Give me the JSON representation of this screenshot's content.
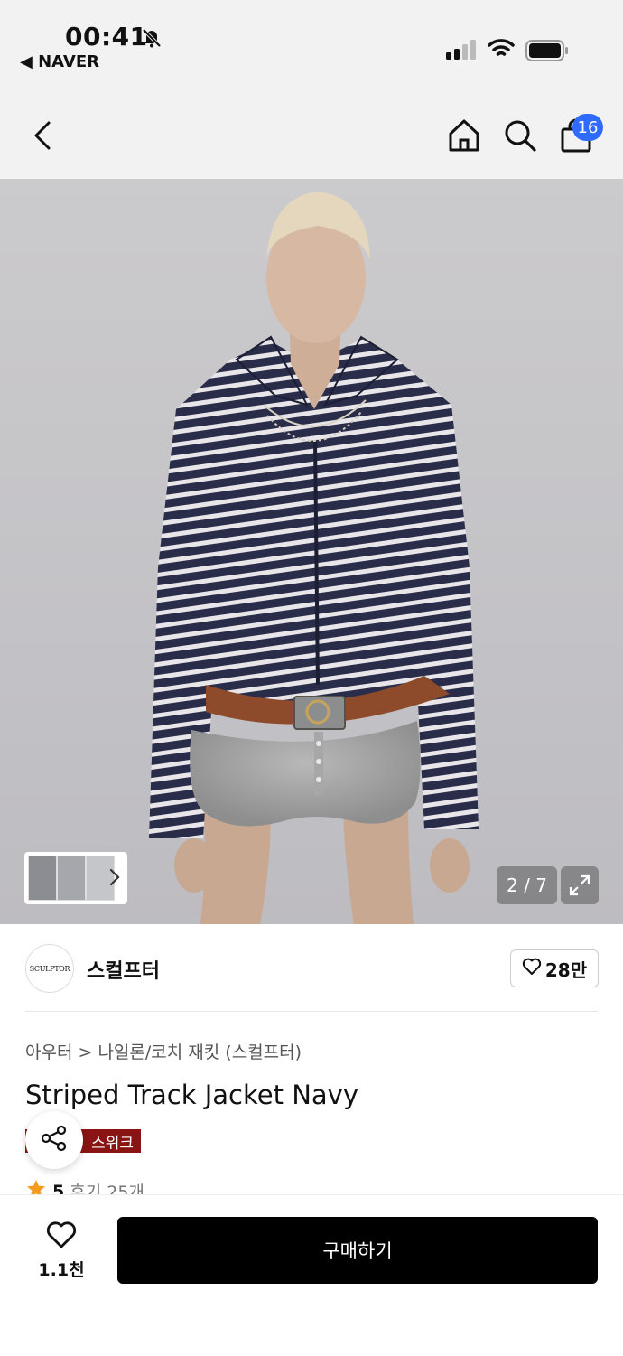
{
  "status_bar": {
    "time": "00:41",
    "back_app": "◀ NAVER"
  },
  "header": {
    "cart_count": "16"
  },
  "gallery": {
    "page": "2 / 7",
    "thumb_colors": [
      "#2b2f3a",
      "#8a8f96",
      "#3c3f45"
    ]
  },
  "brand": {
    "logo_text": "SCULPTOR",
    "name": "스컬프터",
    "followers": "28만"
  },
  "product": {
    "category": "아우터 > 나일론/코치 재킷 (스컬프터)",
    "title": "Striped Track Jacket Navy",
    "promo_badge": "스위크",
    "rating": "5",
    "reviews": "후기 25개"
  },
  "bottom_bar": {
    "like_count": "1.1천",
    "buy_label": "구매하기"
  },
  "colors": {
    "accent_badge": "#2f6bff",
    "promo": "#8a1414",
    "star": "#f59a1b"
  }
}
